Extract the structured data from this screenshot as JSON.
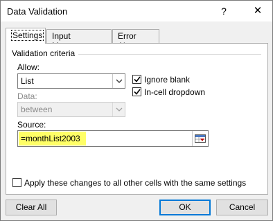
{
  "window": {
    "title": "Data Validation",
    "help_label": "?",
    "close_label": "✕"
  },
  "tabs": [
    {
      "label": "Settings",
      "active": true
    },
    {
      "label": "Input Message",
      "active": false
    },
    {
      "label": "Error Alert",
      "active": false
    }
  ],
  "validation": {
    "group_label": "Validation criteria",
    "allow_label": "Allow:",
    "allow_value": "List",
    "data_label": "Data:",
    "data_value": "between",
    "ignore_blank_label": "Ignore blank",
    "ignore_blank_checked": true,
    "in_cell_dropdown_label": "In-cell dropdown",
    "in_cell_dropdown_checked": true,
    "source_label": "Source:",
    "source_value": "=monthList2003",
    "source_highlight_color": "#ffff66"
  },
  "apply_all": {
    "label": "Apply these changes to all other cells with the same settings",
    "checked": false
  },
  "buttons": {
    "clear_all": "Clear All",
    "ok": "OK",
    "cancel": "Cancel"
  },
  "colors": {
    "dialog_bg": "#f0f0f0",
    "default_button_border": "#0078d7"
  }
}
